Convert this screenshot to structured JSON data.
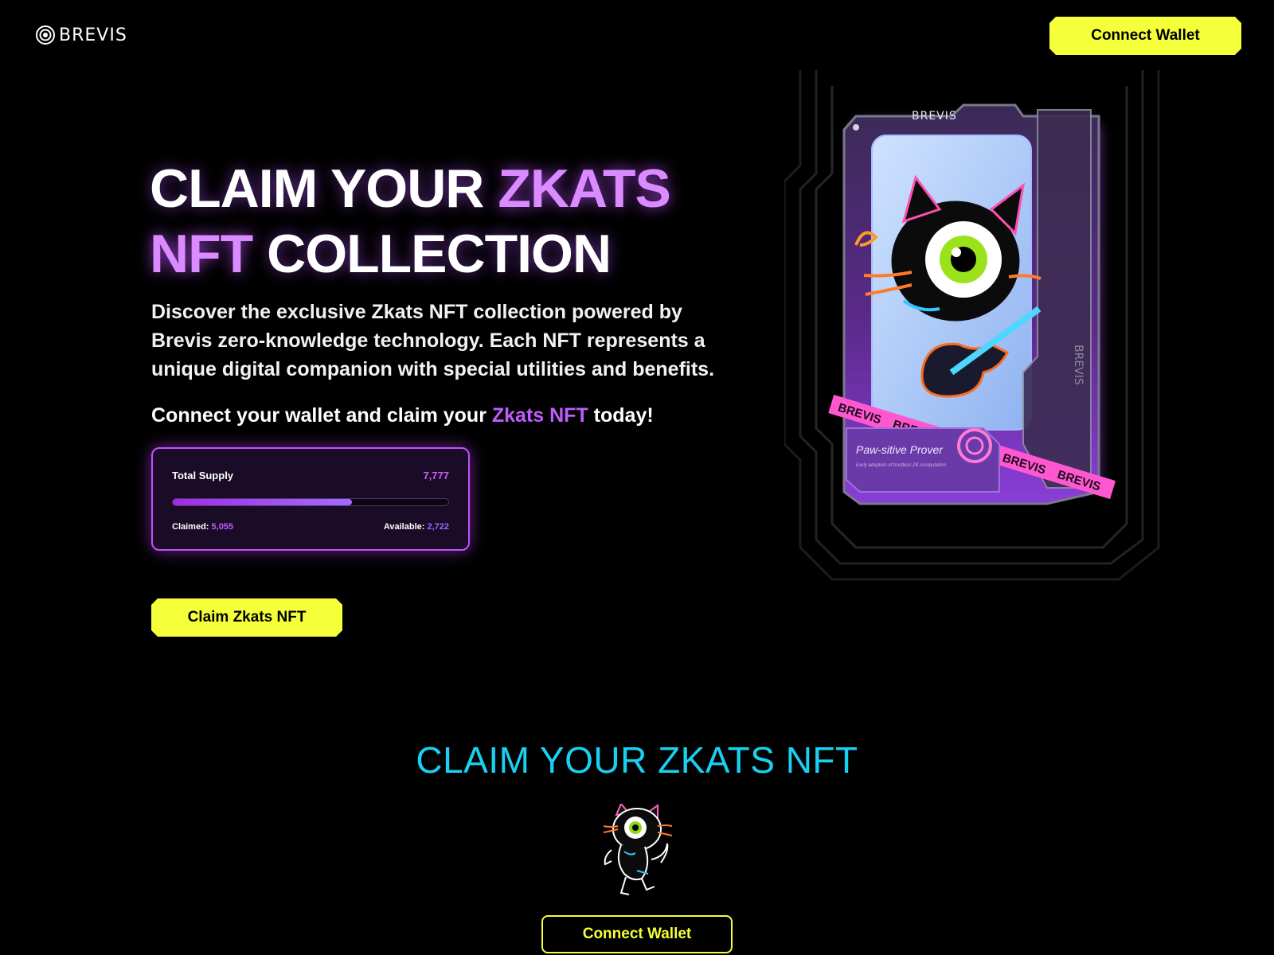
{
  "header": {
    "logo_text": "BREVIS",
    "connect_label": "Connect Wallet"
  },
  "hero": {
    "title_line1_a": "CLAIM YOUR ",
    "title_line1_b": "ZKATS",
    "title_line2_a": "NFT",
    "title_line2_b": " COLLECTION",
    "description": "Discover the exclusive Zkats NFT collection powered by Brevis zero-knowledge technology. Each NFT represents a unique digital companion with special utilities and benefits.",
    "cta_prefix": "Connect your wallet and claim your ",
    "cta_accent": "Zkats NFT",
    "cta_suffix": " today!",
    "claim_label": "Claim Zkats NFT"
  },
  "supply": {
    "label": "Total Supply",
    "total": "7,777",
    "claimed_label": "Claimed: ",
    "claimed": "5,055",
    "available_label": "Available: ",
    "available": "2,722",
    "progress_fraction": 0.65
  },
  "nft_card": {
    "brand_top": "BREVIS",
    "brand_side": "BREVIS",
    "tape_word": "BREVIS",
    "card_title": "Paw-sitive Prover",
    "card_subtitle": "Early adopters of trustless ZK computation"
  },
  "claim_section": {
    "title": "CLAIM YOUR ZKATS NFT",
    "connect_label": "Connect Wallet"
  },
  "colors": {
    "accent_yellow": "#f5ff3a",
    "accent_purple": "#c25cff",
    "accent_cyan": "#1ad0f0"
  }
}
